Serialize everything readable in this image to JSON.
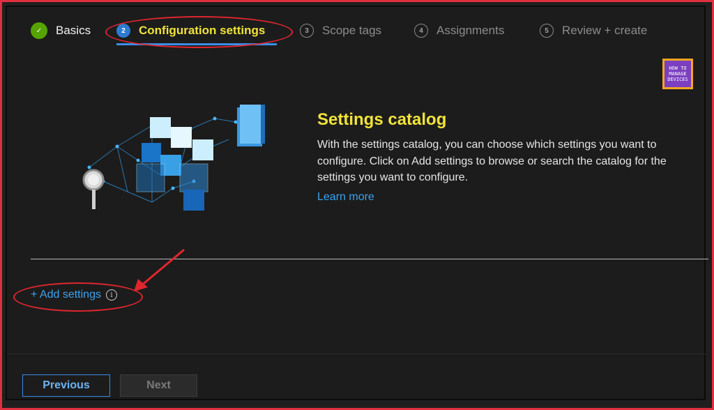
{
  "wizard": {
    "steps": [
      {
        "number": "✓",
        "label": "Basics",
        "state": "done"
      },
      {
        "number": "2",
        "label": "Configuration settings",
        "state": "current"
      },
      {
        "number": "3",
        "label": "Scope tags",
        "state": "todo"
      },
      {
        "number": "4",
        "label": "Assignments",
        "state": "todo"
      },
      {
        "number": "5",
        "label": "Review + create",
        "state": "todo"
      }
    ]
  },
  "logo": {
    "line1": "HOW TO",
    "line2": "MANAGE",
    "line3": "DEVICES"
  },
  "catalog": {
    "title": "Settings catalog",
    "description": "With the settings catalog, you can choose which settings you want to configure. Click on Add settings to browse or search the catalog for the settings you want to configure.",
    "learn_more": "Learn more"
  },
  "add_settings": {
    "label": "+ Add settings",
    "info_icon": "i"
  },
  "footer": {
    "previous": "Previous",
    "next": "Next"
  },
  "colors": {
    "accent": "#3ba3f0",
    "highlight": "#f1e33a",
    "annotation": "#e0262f",
    "done": "#57a300"
  }
}
